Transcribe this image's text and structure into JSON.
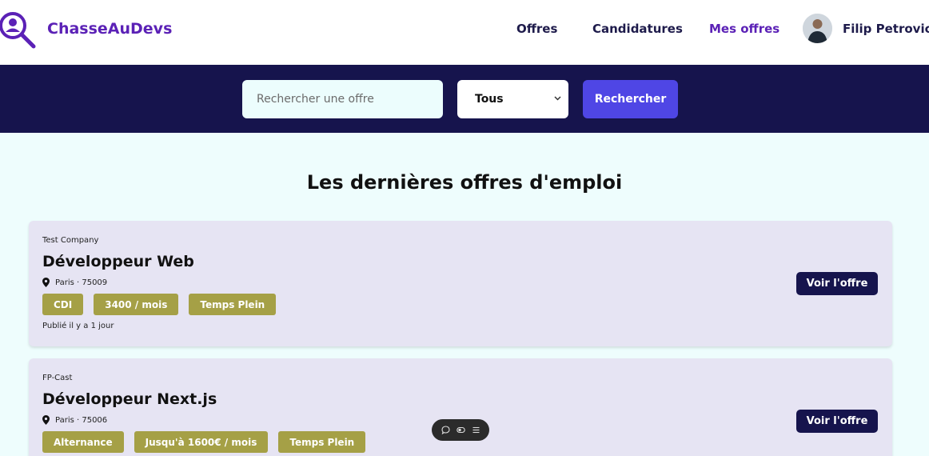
{
  "header": {
    "brand": "ChasseAuDevs",
    "nav": {
      "offres": "Offres",
      "candidatures": "Candidatures",
      "mes_offres": "Mes offres"
    },
    "user_name": "Filip Petrovic"
  },
  "search": {
    "placeholder": "Rechercher une offre",
    "select_value": "Tous",
    "button_label": "Rechercher"
  },
  "main": {
    "title": "Les dernières offres d'emploi",
    "view_label": "Voir l'offre",
    "jobs": [
      {
        "company": "Test Company",
        "title": "Développeur Web",
        "location": "Paris · 75009",
        "tags": [
          "CDI",
          "3400 / mois",
          "Temps Plein"
        ],
        "published": "Publié il y a 1 jour"
      },
      {
        "company": "FP-Cast",
        "title": "Développeur Next.js",
        "location": "Paris · 75006",
        "tags": [
          "Alternance",
          "Jusqu'à 1600€ / mois",
          "Temps Plein"
        ]
      }
    ]
  },
  "colors": {
    "brand": "#5b21b6",
    "navy": "#16144d",
    "accent": "#4f46e5",
    "tag": "#a5a046",
    "card": "#e6e4f3",
    "background": "#eefdfd"
  },
  "icons": {
    "logo": "magnifier-person-icon",
    "location": "map-pin-icon",
    "select": "chevron-down-icon",
    "toolbar": [
      "chat-icon",
      "toggle-icon",
      "menu-icon"
    ]
  }
}
